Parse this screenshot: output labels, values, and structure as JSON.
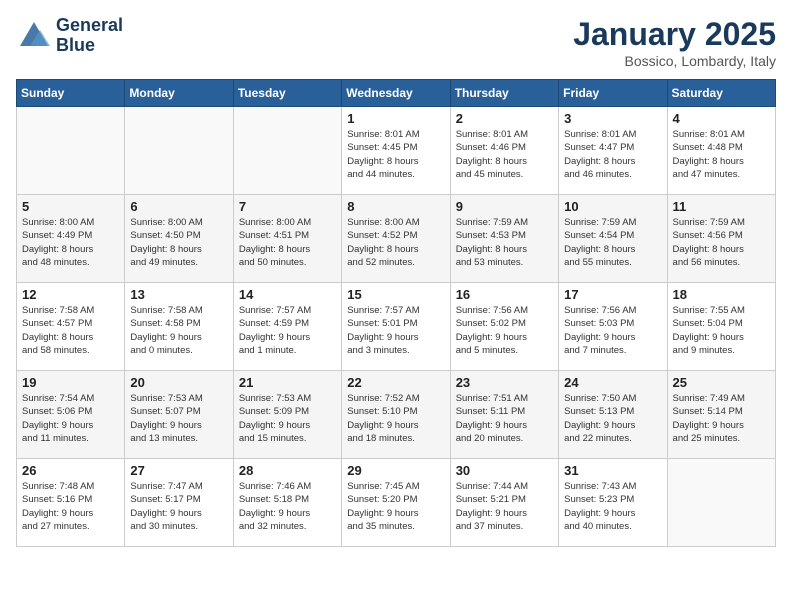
{
  "logo": {
    "line1": "General",
    "line2": "Blue"
  },
  "title": "January 2025",
  "location": "Bossico, Lombardy, Italy",
  "weekdays": [
    "Sunday",
    "Monday",
    "Tuesday",
    "Wednesday",
    "Thursday",
    "Friday",
    "Saturday"
  ],
  "weeks": [
    [
      {
        "day": "",
        "info": ""
      },
      {
        "day": "",
        "info": ""
      },
      {
        "day": "",
        "info": ""
      },
      {
        "day": "1",
        "info": "Sunrise: 8:01 AM\nSunset: 4:45 PM\nDaylight: 8 hours\nand 44 minutes."
      },
      {
        "day": "2",
        "info": "Sunrise: 8:01 AM\nSunset: 4:46 PM\nDaylight: 8 hours\nand 45 minutes."
      },
      {
        "day": "3",
        "info": "Sunrise: 8:01 AM\nSunset: 4:47 PM\nDaylight: 8 hours\nand 46 minutes."
      },
      {
        "day": "4",
        "info": "Sunrise: 8:01 AM\nSunset: 4:48 PM\nDaylight: 8 hours\nand 47 minutes."
      }
    ],
    [
      {
        "day": "5",
        "info": "Sunrise: 8:00 AM\nSunset: 4:49 PM\nDaylight: 8 hours\nand 48 minutes."
      },
      {
        "day": "6",
        "info": "Sunrise: 8:00 AM\nSunset: 4:50 PM\nDaylight: 8 hours\nand 49 minutes."
      },
      {
        "day": "7",
        "info": "Sunrise: 8:00 AM\nSunset: 4:51 PM\nDaylight: 8 hours\nand 50 minutes."
      },
      {
        "day": "8",
        "info": "Sunrise: 8:00 AM\nSunset: 4:52 PM\nDaylight: 8 hours\nand 52 minutes."
      },
      {
        "day": "9",
        "info": "Sunrise: 7:59 AM\nSunset: 4:53 PM\nDaylight: 8 hours\nand 53 minutes."
      },
      {
        "day": "10",
        "info": "Sunrise: 7:59 AM\nSunset: 4:54 PM\nDaylight: 8 hours\nand 55 minutes."
      },
      {
        "day": "11",
        "info": "Sunrise: 7:59 AM\nSunset: 4:56 PM\nDaylight: 8 hours\nand 56 minutes."
      }
    ],
    [
      {
        "day": "12",
        "info": "Sunrise: 7:58 AM\nSunset: 4:57 PM\nDaylight: 8 hours\nand 58 minutes."
      },
      {
        "day": "13",
        "info": "Sunrise: 7:58 AM\nSunset: 4:58 PM\nDaylight: 9 hours\nand 0 minutes."
      },
      {
        "day": "14",
        "info": "Sunrise: 7:57 AM\nSunset: 4:59 PM\nDaylight: 9 hours\nand 1 minute."
      },
      {
        "day": "15",
        "info": "Sunrise: 7:57 AM\nSunset: 5:01 PM\nDaylight: 9 hours\nand 3 minutes."
      },
      {
        "day": "16",
        "info": "Sunrise: 7:56 AM\nSunset: 5:02 PM\nDaylight: 9 hours\nand 5 minutes."
      },
      {
        "day": "17",
        "info": "Sunrise: 7:56 AM\nSunset: 5:03 PM\nDaylight: 9 hours\nand 7 minutes."
      },
      {
        "day": "18",
        "info": "Sunrise: 7:55 AM\nSunset: 5:04 PM\nDaylight: 9 hours\nand 9 minutes."
      }
    ],
    [
      {
        "day": "19",
        "info": "Sunrise: 7:54 AM\nSunset: 5:06 PM\nDaylight: 9 hours\nand 11 minutes."
      },
      {
        "day": "20",
        "info": "Sunrise: 7:53 AM\nSunset: 5:07 PM\nDaylight: 9 hours\nand 13 minutes."
      },
      {
        "day": "21",
        "info": "Sunrise: 7:53 AM\nSunset: 5:09 PM\nDaylight: 9 hours\nand 15 minutes."
      },
      {
        "day": "22",
        "info": "Sunrise: 7:52 AM\nSunset: 5:10 PM\nDaylight: 9 hours\nand 18 minutes."
      },
      {
        "day": "23",
        "info": "Sunrise: 7:51 AM\nSunset: 5:11 PM\nDaylight: 9 hours\nand 20 minutes."
      },
      {
        "day": "24",
        "info": "Sunrise: 7:50 AM\nSunset: 5:13 PM\nDaylight: 9 hours\nand 22 minutes."
      },
      {
        "day": "25",
        "info": "Sunrise: 7:49 AM\nSunset: 5:14 PM\nDaylight: 9 hours\nand 25 minutes."
      }
    ],
    [
      {
        "day": "26",
        "info": "Sunrise: 7:48 AM\nSunset: 5:16 PM\nDaylight: 9 hours\nand 27 minutes."
      },
      {
        "day": "27",
        "info": "Sunrise: 7:47 AM\nSunset: 5:17 PM\nDaylight: 9 hours\nand 30 minutes."
      },
      {
        "day": "28",
        "info": "Sunrise: 7:46 AM\nSunset: 5:18 PM\nDaylight: 9 hours\nand 32 minutes."
      },
      {
        "day": "29",
        "info": "Sunrise: 7:45 AM\nSunset: 5:20 PM\nDaylight: 9 hours\nand 35 minutes."
      },
      {
        "day": "30",
        "info": "Sunrise: 7:44 AM\nSunset: 5:21 PM\nDaylight: 9 hours\nand 37 minutes."
      },
      {
        "day": "31",
        "info": "Sunrise: 7:43 AM\nSunset: 5:23 PM\nDaylight: 9 hours\nand 40 minutes."
      },
      {
        "day": "",
        "info": ""
      }
    ]
  ]
}
